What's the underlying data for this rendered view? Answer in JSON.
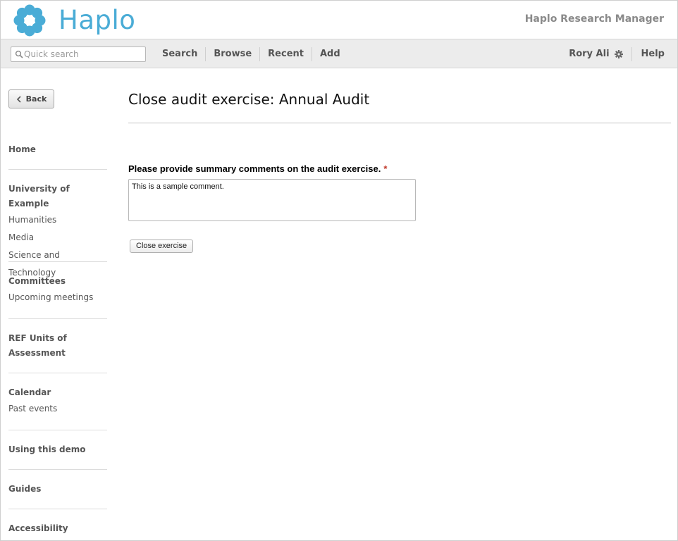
{
  "header": {
    "brand": "Haplo",
    "app_title": "Haplo Research Manager",
    "logo_icon": "haplo-flower-icon",
    "brand_color": "#4aacd6"
  },
  "toolbar": {
    "search": {
      "placeholder": "Quick search",
      "value": ""
    },
    "nav": [
      {
        "label": "Search"
      },
      {
        "label": "Browse"
      },
      {
        "label": "Recent"
      },
      {
        "label": "Add"
      }
    ],
    "user_name": "Rory Ali",
    "help_label": "Help"
  },
  "sidebar": {
    "back_label": "Back",
    "sections": [
      {
        "heading": "Home",
        "links": []
      },
      {
        "heading": "University of Example",
        "links": [
          "Humanities",
          "Media",
          "Science and Technology"
        ]
      },
      {
        "heading": "Committees",
        "links": [
          "Upcoming meetings"
        ]
      },
      {
        "heading": "REF Units of Assessment",
        "links": []
      },
      {
        "heading": "Calendar",
        "links": [
          "Past events"
        ]
      },
      {
        "heading": "Using this demo",
        "links": []
      },
      {
        "heading": "Guides",
        "links": []
      },
      {
        "heading": "Accessibility",
        "links": []
      }
    ]
  },
  "main": {
    "title": "Close audit exercise: Annual Audit",
    "question": "Please provide summary comments on the audit exercise.",
    "required_marker": "*",
    "comment_value": "This is a sample comment.",
    "submit_label": "Close exercise",
    "required_color": "#c0392b"
  }
}
